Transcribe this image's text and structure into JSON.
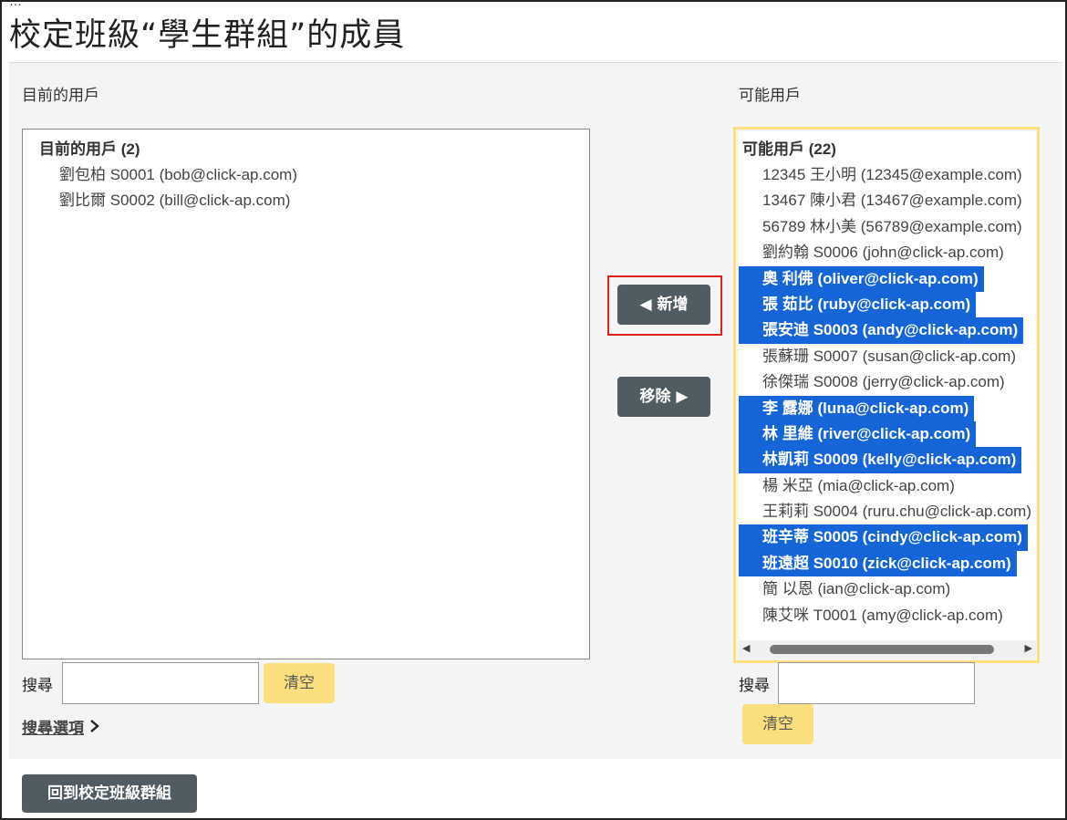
{
  "page": {
    "title": "校定班級“學生群組”的成員"
  },
  "current": {
    "column_label": "目前的用戶",
    "group_label": "目前的用戶 (2)",
    "users": [
      "劉包柏 S0001 (bob@click-ap.com)",
      "劉比爾 S0002 (bill@click-ap.com)"
    ],
    "search_label": "搜尋",
    "search_value": "",
    "clear_label": "清空",
    "search_options_label": "搜尋選項"
  },
  "actions": {
    "add_label": "◀ 新增",
    "remove_label": "移除 ▶"
  },
  "potential": {
    "column_label": "可能用戶",
    "group_label": "可能用戶 (22)",
    "users": [
      {
        "text": "12345 王小明 (12345@example.com)",
        "selected": false
      },
      {
        "text": "13467 陳小君 (13467@example.com)",
        "selected": false
      },
      {
        "text": "56789 林小美 (56789@example.com)",
        "selected": false
      },
      {
        "text": "劉約翰 S0006 (john@click-ap.com)",
        "selected": false
      },
      {
        "text": "奧 利佛 (oliver@click-ap.com)",
        "selected": true
      },
      {
        "text": "張 茹比 (ruby@click-ap.com)",
        "selected": true
      },
      {
        "text": "張安迪 S0003 (andy@click-ap.com)",
        "selected": true
      },
      {
        "text": "張蘇珊 S0007 (susan@click-ap.com)",
        "selected": false
      },
      {
        "text": "徐傑瑞 S0008 (jerry@click-ap.com)",
        "selected": false
      },
      {
        "text": "李 露娜 (luna@click-ap.com)",
        "selected": true
      },
      {
        "text": "林 里維 (river@click-ap.com)",
        "selected": true
      },
      {
        "text": "林凱莉 S0009 (kelly@click-ap.com)",
        "selected": true
      },
      {
        "text": "楊 米亞 (mia@click-ap.com)",
        "selected": false
      },
      {
        "text": "王莉莉 S0004 (ruru.chu@click-ap.com)",
        "selected": false
      },
      {
        "text": "班辛蒂 S0005 (cindy@click-ap.com)",
        "selected": true
      },
      {
        "text": "班遠超 S0010 (zick@click-ap.com)",
        "selected": true
      },
      {
        "text": "簡 以恩 (ian@click-ap.com)",
        "selected": false
      },
      {
        "text": "陳艾咪 T0001 (amy@click-ap.com)",
        "selected": false
      }
    ],
    "search_label": "搜尋",
    "search_value": "",
    "clear_label": "清空"
  },
  "footer": {
    "back_label": "回到校定班級群組"
  },
  "colors": {
    "selected_bg": "#1565d8",
    "button_dark": "#505c61",
    "button_yellow": "#fbdf7e",
    "highlight_red": "#e01e1e"
  }
}
